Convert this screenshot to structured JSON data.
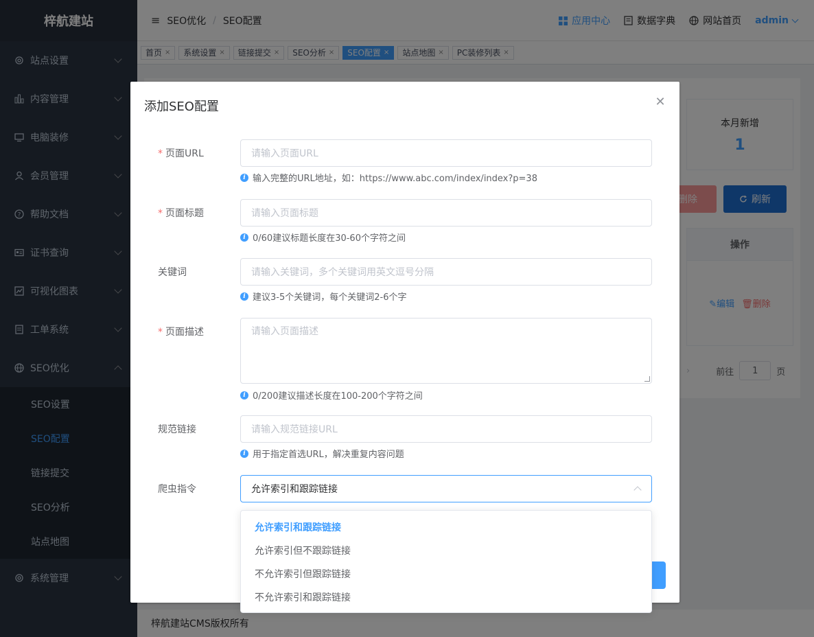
{
  "sidebar": {
    "logo": "梓航建站",
    "items": [
      {
        "label": "站点设置",
        "icon": "gear-icon"
      },
      {
        "label": "内容管理",
        "icon": "bar-chart-icon"
      },
      {
        "label": "电脑装修",
        "icon": "monitor-icon"
      },
      {
        "label": "会员管理",
        "icon": "user-icon"
      },
      {
        "label": "帮助文档",
        "icon": "help-circle-icon"
      },
      {
        "label": "证书查询",
        "icon": "id-card-icon"
      },
      {
        "label": "可视化图表",
        "icon": "line-chart-icon"
      },
      {
        "label": "工单系统",
        "icon": "document-icon"
      },
      {
        "label": "SEO优化",
        "icon": "globe-icon"
      }
    ],
    "seo_submenu": [
      "SEO设置",
      "SEO配置",
      "链接提交",
      "SEO分析",
      "站点地图"
    ],
    "system": {
      "label": "系统管理",
      "icon": "gear-icon"
    }
  },
  "header": {
    "breadcrumb": [
      "SEO优化",
      "SEO配置"
    ],
    "app_center": "应用中心",
    "data_dict": "数据字典",
    "site_home": "网站首页",
    "user": "admin"
  },
  "tags": [
    {
      "label": "首页",
      "active": false
    },
    {
      "label": "系统设置",
      "active": false
    },
    {
      "label": "链接提交",
      "active": false
    },
    {
      "label": "SEO分析",
      "active": false
    },
    {
      "label": "SEO配置",
      "active": true
    },
    {
      "label": "站点地图",
      "active": false
    },
    {
      "label": "PC装修列表",
      "active": false
    }
  ],
  "background": {
    "stat_label": "本月新增",
    "stat_value": "1",
    "delete_label": "删除",
    "refresh_label": "刷新",
    "col_actions": "操作",
    "edit_label": "编辑",
    "row_delete_label": "删除",
    "pager_goto": "前往",
    "pager_page": "1",
    "pager_unit": "页"
  },
  "footer": "梓航建站CMS版权所有",
  "dialog": {
    "title": "添加SEO配置",
    "url": {
      "label": "页面URL",
      "placeholder": "请输入页面URL",
      "hint": "输入完整的URL地址，如：https://www.abc.com/index/index?p=38"
    },
    "page_title": {
      "label": "页面标题",
      "placeholder": "请输入页面标题",
      "hint": "0/60建议标题长度在30-60个字符之间"
    },
    "keywords": {
      "label": "关键词",
      "placeholder": "请输入关键词，多个关键词用英文逗号分隔",
      "hint": "建议3-5个关键词，每个关键词2-6个字"
    },
    "description": {
      "label": "页面描述",
      "placeholder": "请输入页面描述",
      "hint": "0/200建议描述长度在100-200个字符之间"
    },
    "canonical": {
      "label": "规范链接",
      "placeholder": "请输入规范链接URL",
      "hint": "用于指定首选URL，解决重复内容问题"
    },
    "robots": {
      "label": "爬虫指令",
      "value": "允许索引和跟踪链接"
    }
  },
  "dropdown": {
    "options": [
      "允许索引和跟踪链接",
      "允许索引但不跟踪链接",
      "不允许索引但跟踪链接",
      "不允许索引和跟踪链接"
    ],
    "selected_index": 0
  },
  "colors": {
    "accent": "#409eff",
    "sidebar_bg": "#2b3442",
    "danger": "#f56c6c"
  }
}
